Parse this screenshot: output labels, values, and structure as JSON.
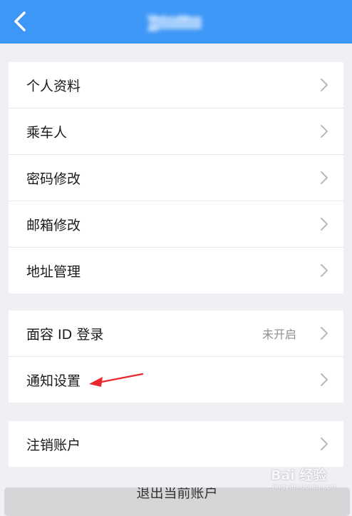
{
  "header": {
    "title": "账户设置",
    "back_icon": "chevron-left-icon"
  },
  "groups": [
    {
      "items": [
        {
          "label": "个人资料",
          "icon": "chevron-right-icon"
        },
        {
          "label": "乘车人",
          "icon": "chevron-right-icon"
        },
        {
          "label": "密码修改",
          "icon": "chevron-right-icon"
        },
        {
          "label": "邮箱修改",
          "icon": "chevron-right-icon"
        },
        {
          "label": "地址管理",
          "icon": "chevron-right-icon"
        }
      ]
    },
    {
      "items": [
        {
          "label": "面容 ID 登录",
          "value": "未开启",
          "icon": "chevron-right-icon"
        },
        {
          "label": "通知设置",
          "icon": "chevron-right-icon"
        }
      ]
    },
    {
      "items": [
        {
          "label": "注销账户",
          "icon": "chevron-right-icon"
        }
      ]
    }
  ],
  "logout_button": {
    "label": "退出当前账户"
  },
  "watermark": {
    "text": "Bai 经验",
    "url": "jingyan.baidu.com"
  },
  "colors": {
    "header_bg": "#3d97f6",
    "page_bg": "#efeff4",
    "annotation_arrow": "#e8282c"
  }
}
